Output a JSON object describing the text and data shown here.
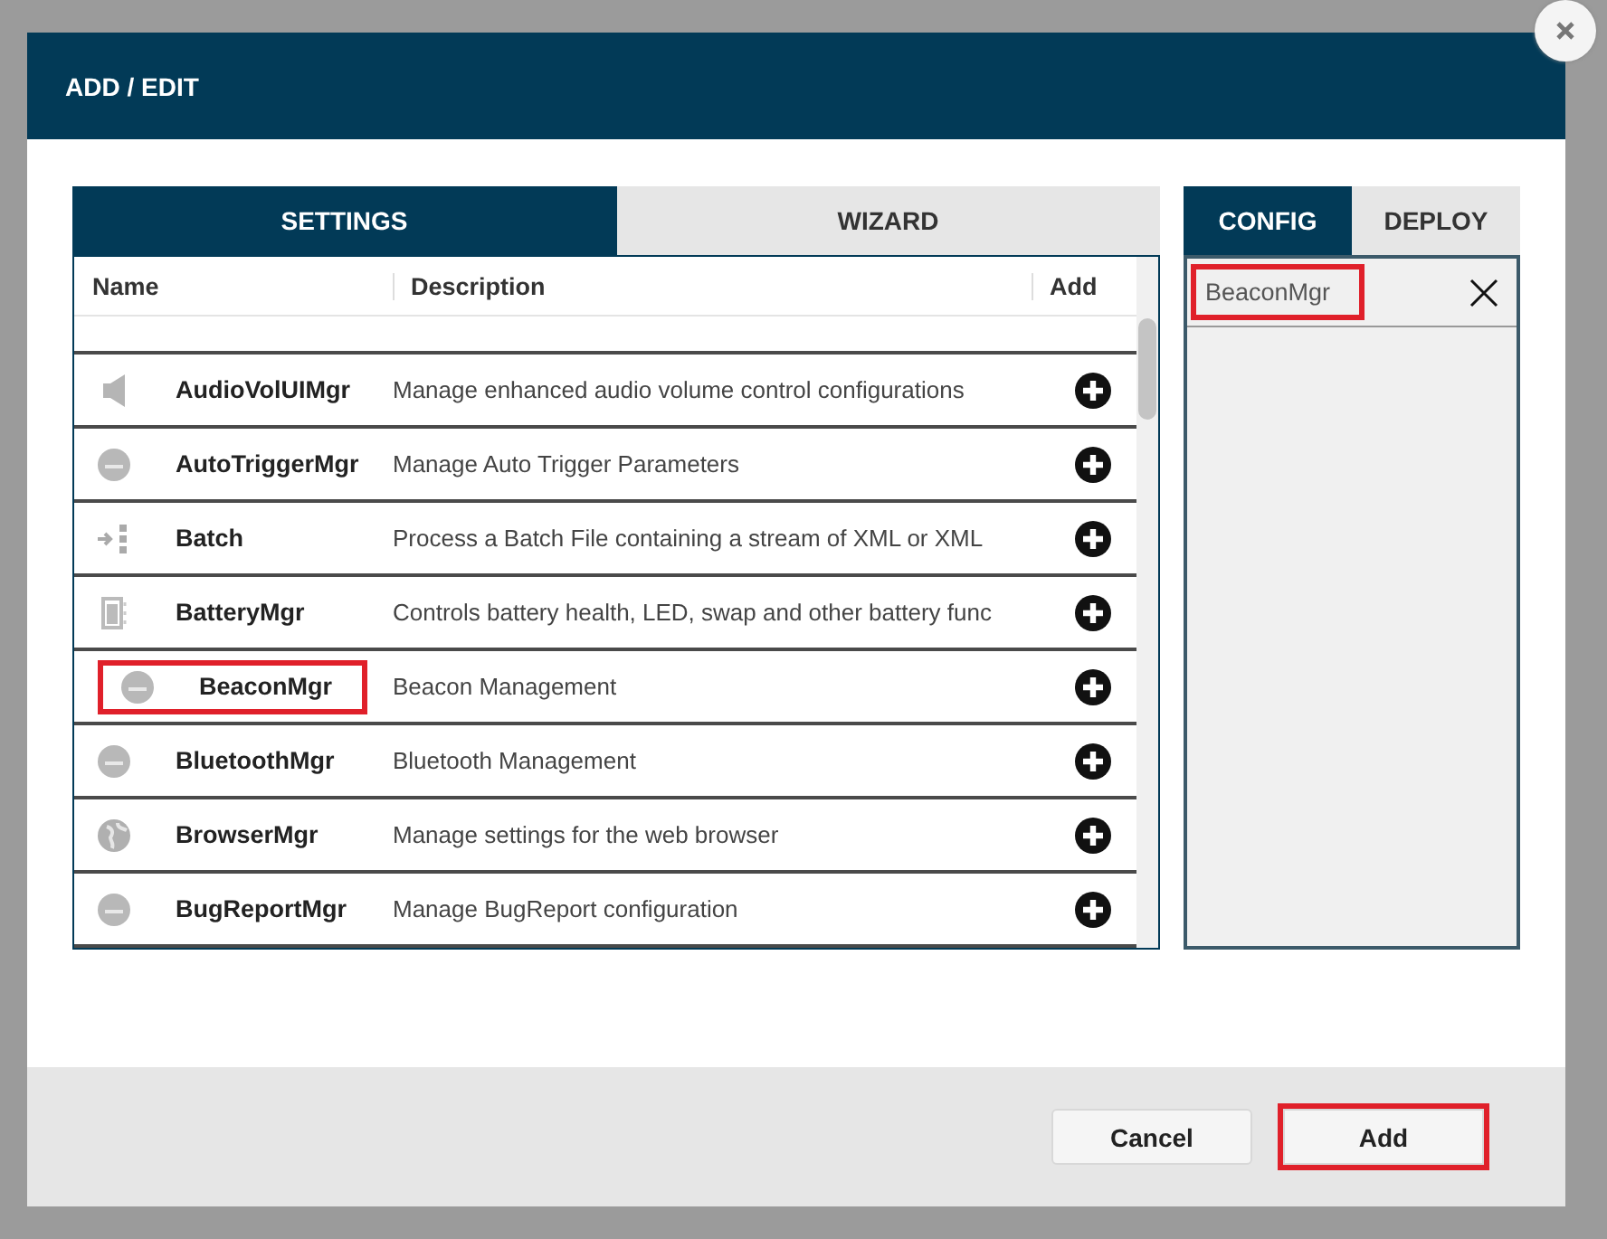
{
  "dialog": {
    "title": "ADD / EDIT"
  },
  "left_tabs": [
    {
      "label": "SETTINGS",
      "selected": true
    },
    {
      "label": "WIZARD",
      "selected": false
    }
  ],
  "table": {
    "columns": [
      "Name",
      "Description",
      "Add"
    ],
    "rows": [
      {
        "kind": "speaker",
        "name": "AudioVolUIMgr",
        "description": "Manage enhanced audio volume control configurations",
        "highlighted": false
      },
      {
        "kind": "sn",
        "name": "AutoTriggerMgr",
        "description": "Manage Auto Trigger Parameters",
        "highlighted": false
      },
      {
        "kind": "batch",
        "name": "Batch",
        "description": "Process a Batch File containing a stream of XML or XML",
        "highlighted": false
      },
      {
        "kind": "battery",
        "name": "BatteryMgr",
        "description": "Controls battery health, LED, swap and other battery func",
        "highlighted": false
      },
      {
        "kind": "sn",
        "name": "BeaconMgr",
        "description": "Beacon Management",
        "highlighted": true
      },
      {
        "kind": "sn",
        "name": "BluetoothMgr",
        "description": "Bluetooth Management",
        "highlighted": false
      },
      {
        "kind": "globe",
        "name": "BrowserMgr",
        "description": "Manage settings for the web browser",
        "highlighted": false
      },
      {
        "kind": "sn",
        "name": "BugReportMgr",
        "description": "Manage BugReport configuration",
        "highlighted": false
      }
    ]
  },
  "right_tabs": [
    {
      "label": "CONFIG",
      "selected": true
    },
    {
      "label": "DEPLOY",
      "selected": false
    }
  ],
  "config_items": [
    {
      "label": "BeaconMgr",
      "highlighted": true
    }
  ],
  "buttons": [
    {
      "label": "Cancel",
      "highlighted": false
    },
    {
      "label": "Add",
      "highlighted": true
    }
  ]
}
